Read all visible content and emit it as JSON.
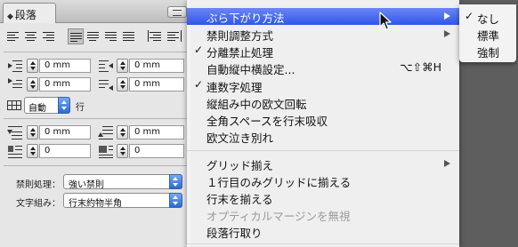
{
  "panel": {
    "tab_title": "段落",
    "fields": {
      "left_indent": "0 mm",
      "right_indent": "0 mm",
      "first_line_indent": "0 mm",
      "last_line_right_indent": "0 mm",
      "space_before": "0 mm",
      "space_after": "0 mm",
      "drop_cap_lines": "0",
      "drop_cap_chars": "0"
    },
    "leading_value": "自動",
    "leading_unit": "行",
    "kinsoku_label": "禁則処理：",
    "kinsoku_value": "強い禁則",
    "mojikumi_label": "文字組み：",
    "mojikumi_value": "行末約物半角"
  },
  "menu": {
    "items": [
      {
        "label": "ぶら下がり方法",
        "checked": false,
        "submenu": true,
        "highlighted": true
      },
      {
        "label": "禁則調整方式",
        "checked": false,
        "submenu": true
      },
      {
        "label": "分離禁止処理",
        "checked": true
      },
      {
        "label": "自動縦中横設定...",
        "shortcut": "⌥⇧⌘H"
      },
      {
        "label": "連数字処理",
        "checked": true
      },
      {
        "label": "縦組み中の欧文回転"
      },
      {
        "label": "全角スペースを行末吸収"
      },
      {
        "label": "欧文泣き別れ"
      },
      {
        "label": "グリッド揃え",
        "submenu": true
      },
      {
        "label": "１行目のみグリッドに揃える"
      },
      {
        "label": "行末を揃える"
      },
      {
        "label": "オプティカルマージンを無視",
        "disabled": true
      },
      {
        "label": "段落行取り"
      }
    ],
    "check_glyph": "✓"
  },
  "submenu": {
    "items": [
      {
        "label": "なし",
        "checked": true
      },
      {
        "label": "標準",
        "checked": false
      },
      {
        "label": "強制",
        "checked": false
      }
    ]
  },
  "colors": {
    "highlight": "#3b62ee",
    "menu_bg": "#f4f4f4",
    "desktop": "#5e5e5e",
    "popup_accent": "#2a6ad8"
  }
}
